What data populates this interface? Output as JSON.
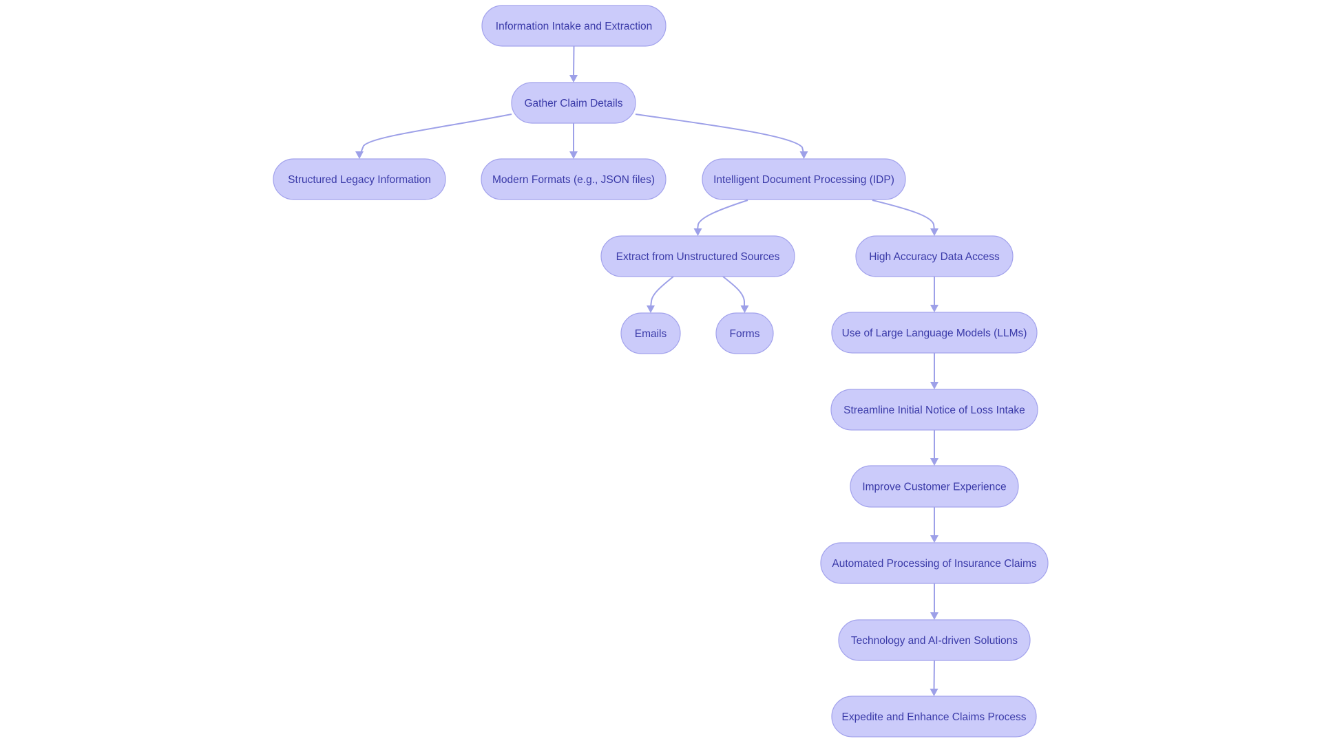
{
  "diagram": {
    "type": "flowchart",
    "direction": "top-down",
    "colors": {
      "node_fill": "#cbcbfa",
      "node_stroke": "#a2a2ec",
      "edge": "#9da0e8",
      "text": "#3a3aa8",
      "background": "#ffffff"
    },
    "nodes": [
      {
        "id": "intake",
        "label": "Information Intake and Extraction"
      },
      {
        "id": "gather",
        "label": "Gather Claim Details"
      },
      {
        "id": "legacy",
        "label": "Structured Legacy Information"
      },
      {
        "id": "modern",
        "label": "Modern Formats (e.g., JSON files)"
      },
      {
        "id": "idp",
        "label": "Intelligent Document Processing (IDP)"
      },
      {
        "id": "extract",
        "label": "Extract from Unstructured Sources"
      },
      {
        "id": "accuracy",
        "label": "High Accuracy Data Access"
      },
      {
        "id": "emails",
        "label": "Emails"
      },
      {
        "id": "forms",
        "label": "Forms"
      },
      {
        "id": "llms",
        "label": "Use of Large Language Models (LLMs)"
      },
      {
        "id": "fnol",
        "label": "Streamline Initial Notice of Loss Intake"
      },
      {
        "id": "cx",
        "label": "Improve Customer Experience"
      },
      {
        "id": "automated",
        "label": "Automated Processing of Insurance Claims"
      },
      {
        "id": "tech",
        "label": "Technology and AI-driven Solutions"
      },
      {
        "id": "expedite",
        "label": "Expedite and Enhance Claims Process"
      }
    ],
    "edges": [
      {
        "from": "intake",
        "to": "gather"
      },
      {
        "from": "gather",
        "to": "legacy"
      },
      {
        "from": "gather",
        "to": "modern"
      },
      {
        "from": "gather",
        "to": "idp"
      },
      {
        "from": "idp",
        "to": "extract"
      },
      {
        "from": "idp",
        "to": "accuracy"
      },
      {
        "from": "extract",
        "to": "emails"
      },
      {
        "from": "extract",
        "to": "forms"
      },
      {
        "from": "accuracy",
        "to": "llms"
      },
      {
        "from": "llms",
        "to": "fnol"
      },
      {
        "from": "fnol",
        "to": "cx"
      },
      {
        "from": "cx",
        "to": "automated"
      },
      {
        "from": "automated",
        "to": "tech"
      },
      {
        "from": "tech",
        "to": "expedite"
      }
    ]
  }
}
